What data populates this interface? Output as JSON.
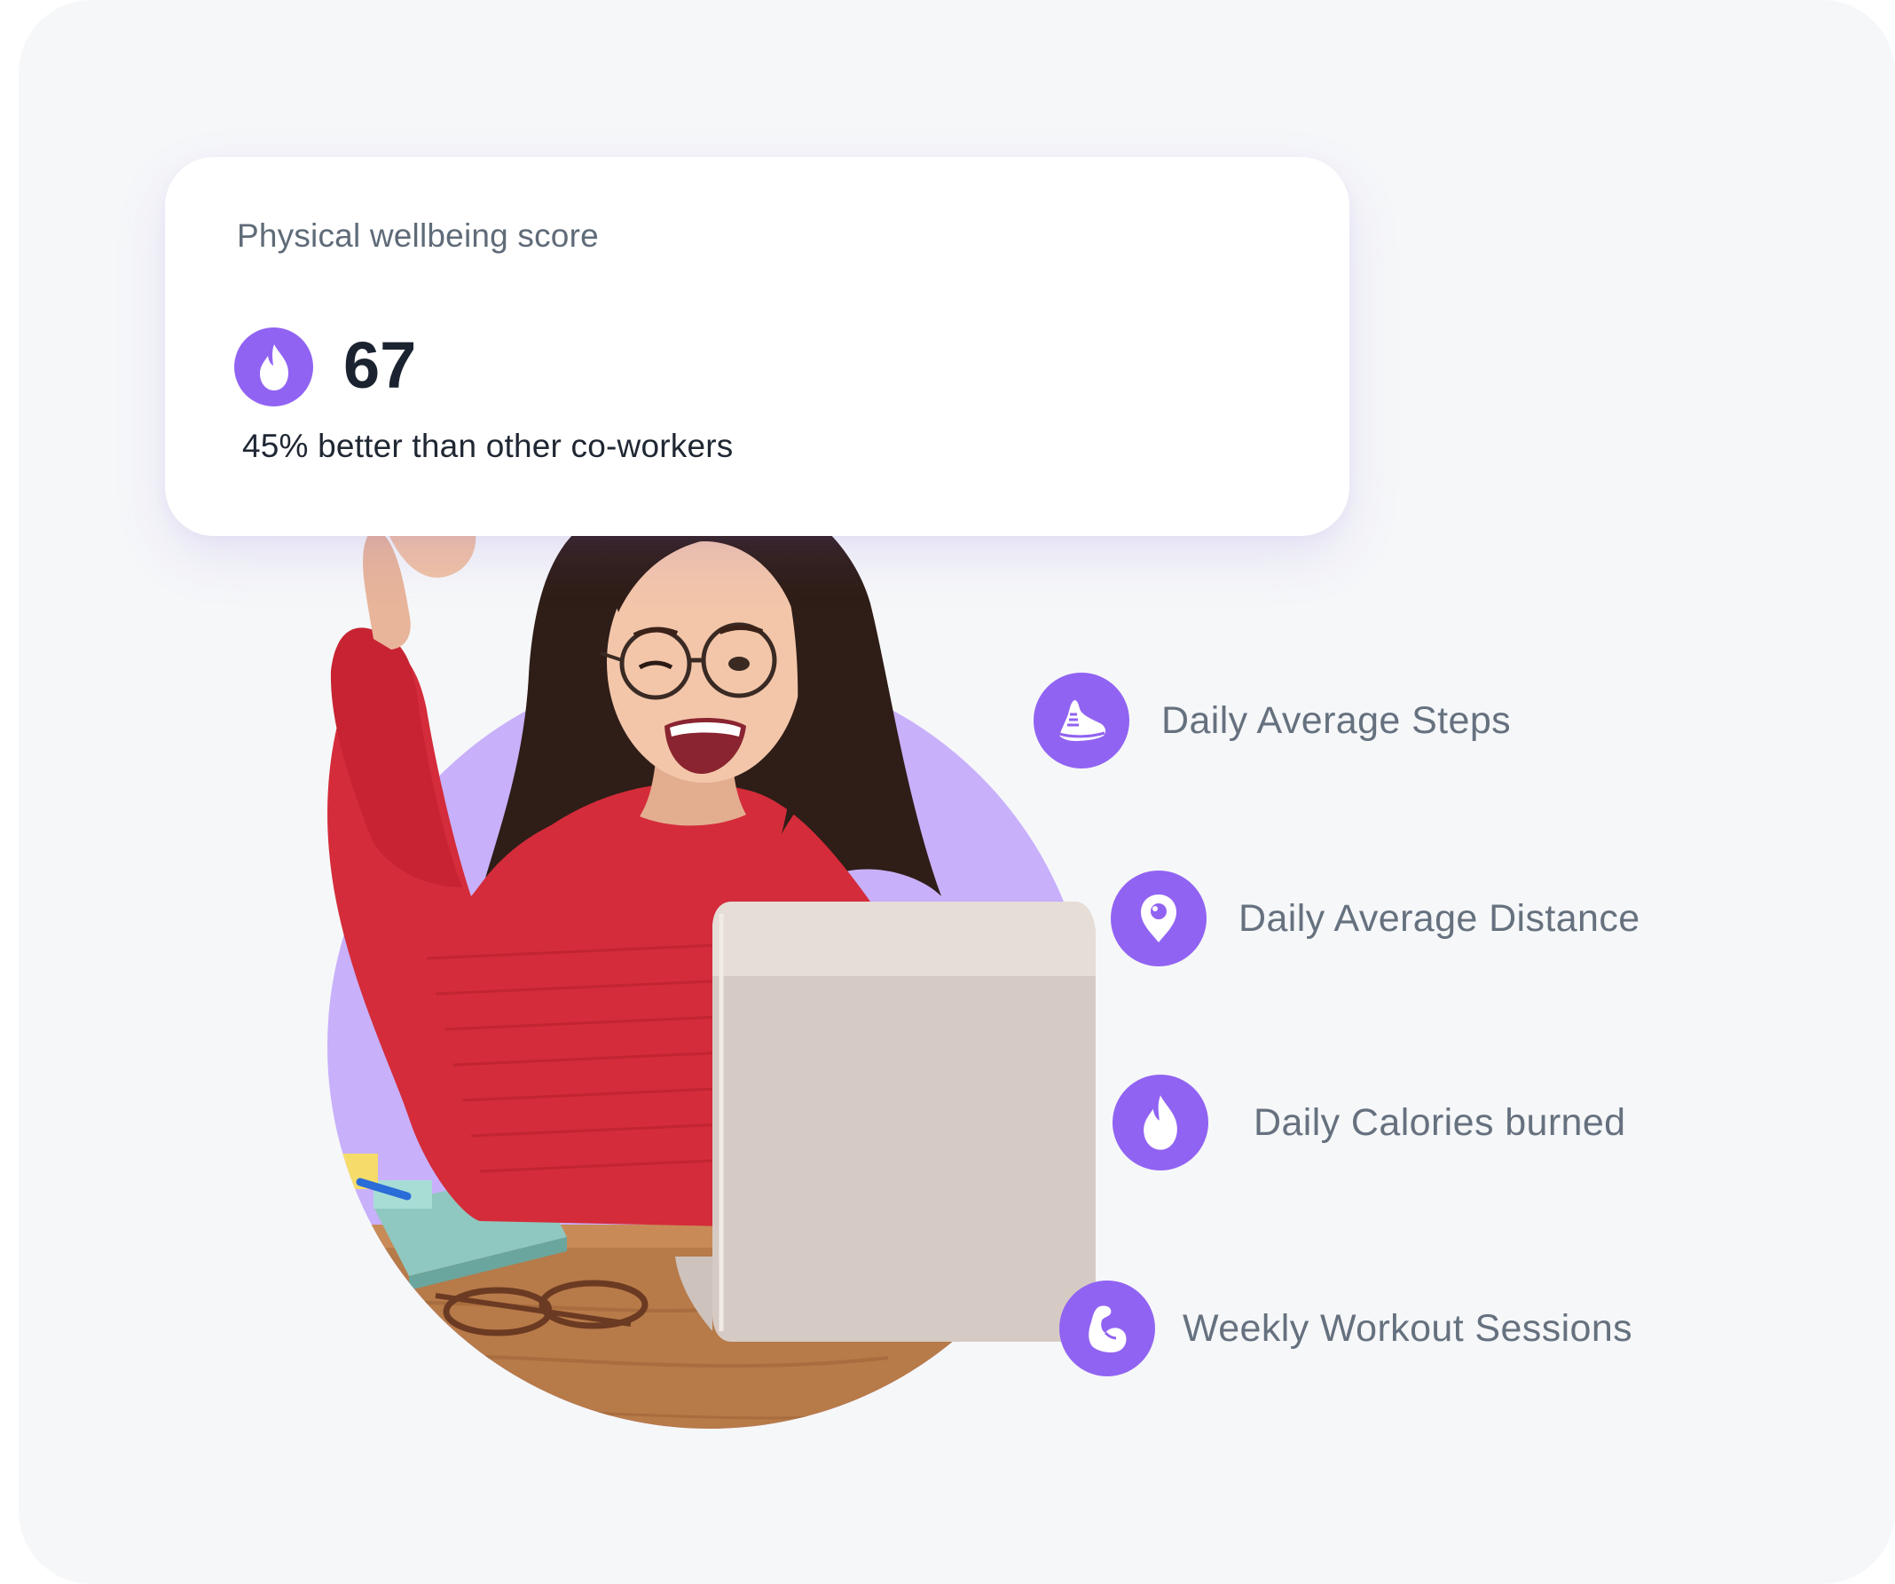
{
  "score_card": {
    "label": "Physical wellbeing score",
    "icon": "flame-icon",
    "value": "67",
    "comparison": "45% better than other co-workers"
  },
  "hero_image": {
    "subject": "person-at-laptop-flexing-arm"
  },
  "metrics": [
    {
      "icon": "sneaker-icon",
      "label": "Daily Average Steps"
    },
    {
      "icon": "map-pin-icon",
      "label": "Daily Average Distance"
    },
    {
      "icon": "flame-icon",
      "label": "Daily Calories burned"
    },
    {
      "icon": "flexed-arm-icon",
      "label": "Weekly Workout Sessions"
    }
  ],
  "colors": {
    "accent": "#9163f2",
    "circle_backdrop": "#c8b0fb",
    "background": "#f6f7f9",
    "card": "#ffffff",
    "label_text": "#66717f",
    "value_text": "#1b2230",
    "sweater": "#d42c3a"
  }
}
